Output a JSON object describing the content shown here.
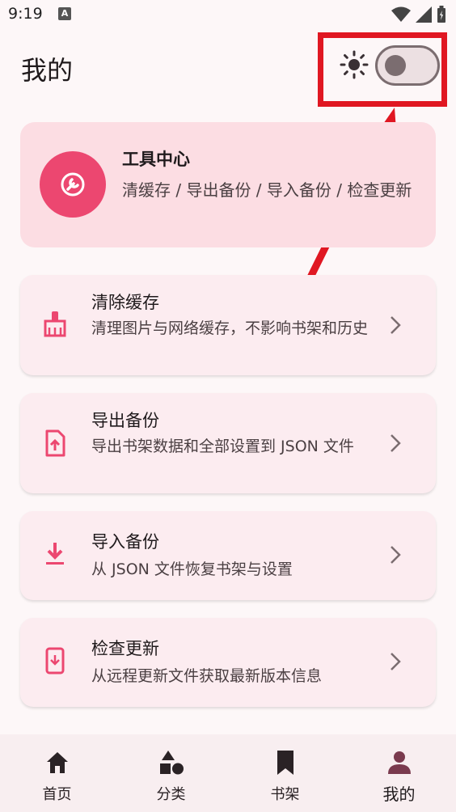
{
  "status_bar": {
    "time": "9:19",
    "app_badge": "A"
  },
  "header": {
    "title": "我的"
  },
  "tools_card": {
    "title": "工具中心",
    "description": "清缓存 / 导出备份 / 导入备份 / 检查更新"
  },
  "items": [
    {
      "title": "清除缓存",
      "desc": "清理图片与网络缓存，不影响书架和历史",
      "icon": "broom-icon"
    },
    {
      "title": "导出备份",
      "desc": "导出书架数据和全部设置到 JSON 文件",
      "icon": "file-upload-icon"
    },
    {
      "title": "导入备份",
      "desc": "从 JSON 文件恢复书架与设置",
      "icon": "download-icon"
    },
    {
      "title": "检查更新",
      "desc": "从远程更新文件获取最新版本信息",
      "icon": "phone-update-icon"
    }
  ],
  "bottom_nav": [
    {
      "label": "首页",
      "icon": "home-icon"
    },
    {
      "label": "分类",
      "icon": "category-icon"
    },
    {
      "label": "书架",
      "icon": "bookmark-icon"
    },
    {
      "label": "我的",
      "icon": "person-icon",
      "active": true
    }
  ],
  "colors": {
    "accent": "#ec4770",
    "annotation": "#e01722",
    "card": "#fcecf0",
    "tools_card": "#fcdde3"
  }
}
